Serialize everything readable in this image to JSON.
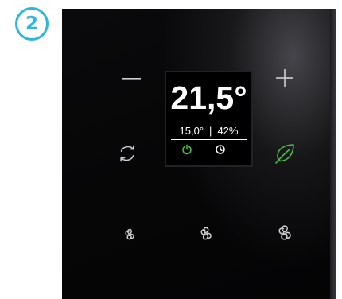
{
  "step": {
    "number": "2"
  },
  "display": {
    "temperature": "21,5°",
    "setpoint": "15,0°",
    "separator": "|",
    "humidity": "42%"
  },
  "icons": {
    "decrease": "minus-icon",
    "increase": "plus-icon",
    "mode": "refresh-icon",
    "eco": "leaf-icon",
    "power": "power-icon",
    "timer": "clock-icon",
    "fan_low": "fan-icon",
    "fan_medium": "fan-icon",
    "fan_high": "fan-icon"
  },
  "colors": {
    "badge": "#2bb8dc",
    "eco_active": "#4bbf4a",
    "panel_icons": "#cfcfd2",
    "display_text": "#ffffff",
    "display_status_green": "#4bbf4a"
  }
}
